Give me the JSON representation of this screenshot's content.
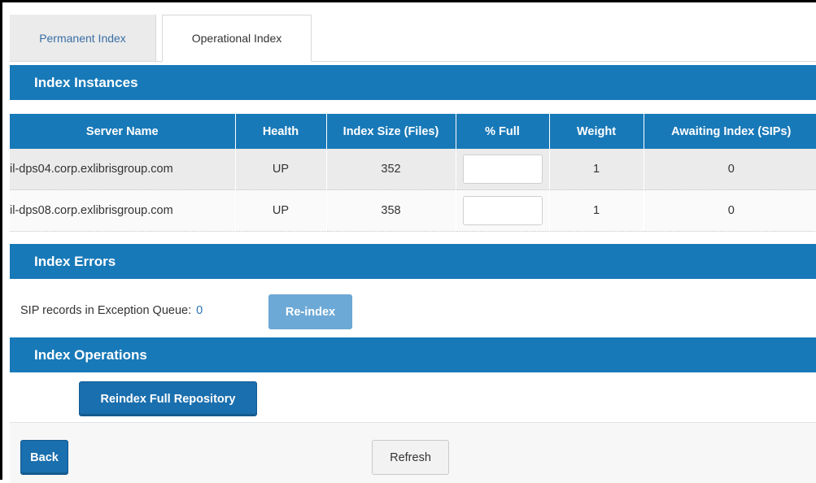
{
  "tabs": [
    {
      "label": "Permanent Index",
      "active": false
    },
    {
      "label": "Operational Index",
      "active": true
    }
  ],
  "sections": {
    "instances": "Index Instances",
    "errors": "Index Errors",
    "operations": "Index Operations"
  },
  "table": {
    "headers": [
      "Server Name",
      "Health",
      "Index Size (Files)",
      "% Full",
      "Weight",
      "Awaiting Index (SIPs)"
    ],
    "rows": [
      {
        "server": "il-dps04.corp.exlibrisgroup.com",
        "health": "UP",
        "size": "352",
        "full": "",
        "weight": "1",
        "awaiting": "0"
      },
      {
        "server": "il-dps08.corp.exlibrisgroup.com",
        "health": "UP",
        "size": "358",
        "full": "",
        "weight": "1",
        "awaiting": "0"
      }
    ]
  },
  "errors": {
    "label": "SIP records in Exception Queue:",
    "count": "0",
    "reindex_button": "Re-index"
  },
  "operations": {
    "reindex_full_button": "Reindex Full Repository"
  },
  "footer": {
    "back_button": "Back",
    "refresh_button": "Refresh"
  },
  "colors": {
    "section_bar": "#1879b8",
    "primary_button": "#1a6fae",
    "disabled_button": "#6da9d6",
    "link_blue": "#2a72b5"
  }
}
